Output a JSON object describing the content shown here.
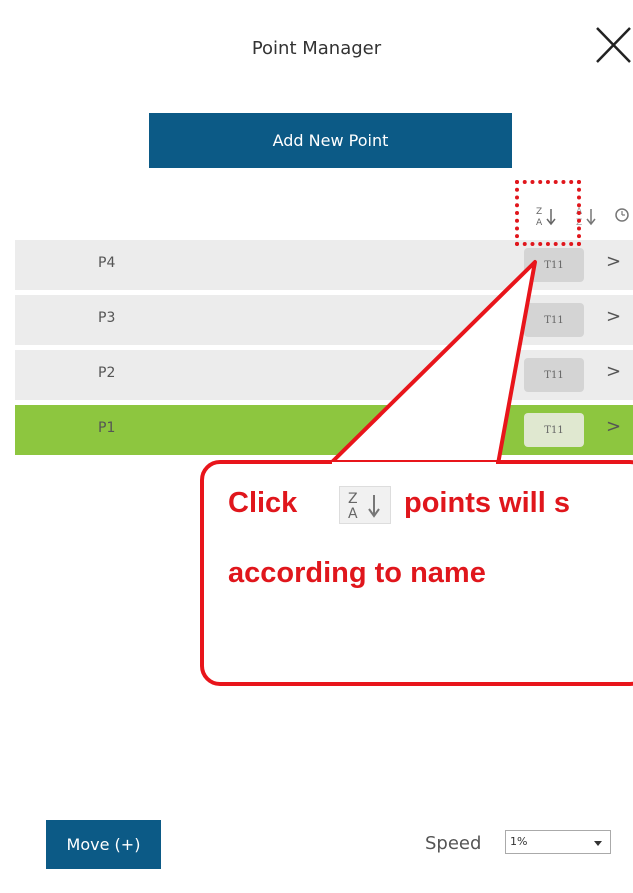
{
  "header": {
    "title": "Point Manager",
    "close_icon": "close-icon"
  },
  "actions": {
    "add_label": "Add New Point"
  },
  "sort": [
    {
      "icon": "sort-name-desc-icon"
    },
    {
      "icon": "sort-name-asc-icon"
    },
    {
      "icon": "sort-time-icon"
    }
  ],
  "points": [
    {
      "name": "P4",
      "tag": "T11",
      "arrow": ">",
      "selected": false
    },
    {
      "name": "P3",
      "tag": "T11",
      "arrow": ">",
      "selected": false
    },
    {
      "name": "P2",
      "tag": "T11",
      "arrow": ">",
      "selected": false
    },
    {
      "name": "P1",
      "tag": "T11",
      "arrow": ">",
      "selected": true
    }
  ],
  "callout": {
    "line1_prefix": "Click",
    "line1_suffix": "points will s",
    "line2": "according to name",
    "color": "#e0161c"
  },
  "footer": {
    "move_label": "Move (+)",
    "speed_label": "Speed",
    "speed_value": "1%"
  },
  "colors": {
    "primary": "#0c5a86",
    "selected": "#8dc63f",
    "row": "#ececec"
  }
}
